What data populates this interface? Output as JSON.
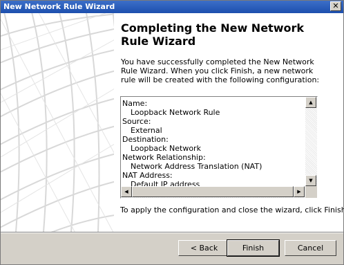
{
  "window": {
    "title": "New Network Rule Wizard",
    "close_glyph": "✕"
  },
  "heading": "Completing the New Network Rule Wizard",
  "description": "You have successfully completed the New Network Rule Wizard. When you click Finish, a new network rule will be created with the following configuration:",
  "summary": [
    {
      "label": "Name:",
      "value": "Loopback Network Rule"
    },
    {
      "label": "Source:",
      "value": "External"
    },
    {
      "label": "Destination:",
      "value": "Loopback Network"
    },
    {
      "label": "Network Relationship:",
      "value": "Network Address Translation (NAT)"
    },
    {
      "label": "NAT Address:",
      "value": "Default IP address"
    }
  ],
  "instruction": "To apply the configuration and close the wizard, click Finish.",
  "buttons": {
    "back": "< Back",
    "finish": "Finish",
    "cancel": "Cancel"
  },
  "scroll_icons": {
    "up": "▲",
    "down": "▼",
    "left": "◀",
    "right": "▶"
  }
}
